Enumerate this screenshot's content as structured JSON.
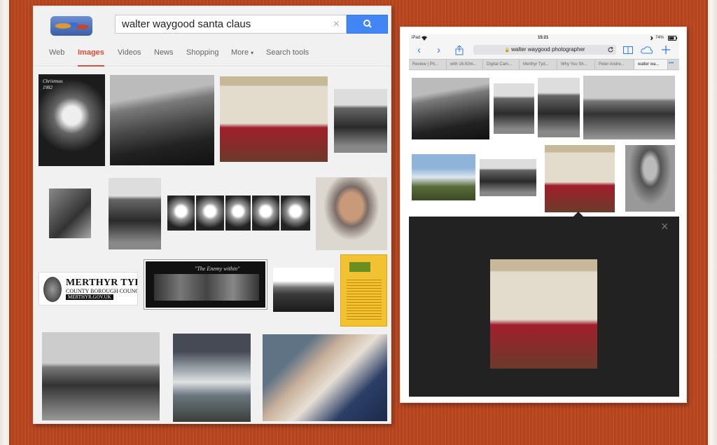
{
  "google": {
    "search_query": "walter waygood santa claus",
    "clear_glyph": "×",
    "tabs": [
      "Web",
      "Images",
      "Videos",
      "News",
      "Shopping",
      "More",
      "Search tools"
    ],
    "more_caret": "▾",
    "active_tab": "Images",
    "thumbs": {
      "christmas_card": "Christmas 1982",
      "merthyr_line1": "MERTHYR TYDFIL",
      "merthyr_line2": "COUNTY BOROUGH COUNCIL",
      "merthyr_line3": "MERTHYR.GOV.UK",
      "enemy_title": "\"The Enemy within\""
    }
  },
  "ipad": {
    "status": {
      "device": "iPad",
      "time": "15:21",
      "battery": "74%"
    },
    "address": "walter waygood photographer",
    "tabs": [
      "Review | Ph...",
      "with 16-50m...",
      "Digital Cam...",
      "Merthyr Tyd...",
      "Why You Sh...",
      "Peter Andre...",
      "walter wa..."
    ],
    "active_tab_index": 6,
    "nav": {
      "back": "‹",
      "forward": "›",
      "more": "•••"
    },
    "viewer_close": "×"
  },
  "colors": {
    "background": "#b9461f",
    "google_blue": "#4285f4",
    "google_red": "#dd4b39",
    "safari_blue": "#2d7cf6",
    "viewer_bg": "#222222"
  },
  "icons": [
    "search-icon",
    "share-icon",
    "reload-icon",
    "lock-icon",
    "bookmarks-icon",
    "cloud-icon",
    "plus-icon",
    "wifi-icon",
    "bluetooth-icon",
    "battery-icon"
  ]
}
